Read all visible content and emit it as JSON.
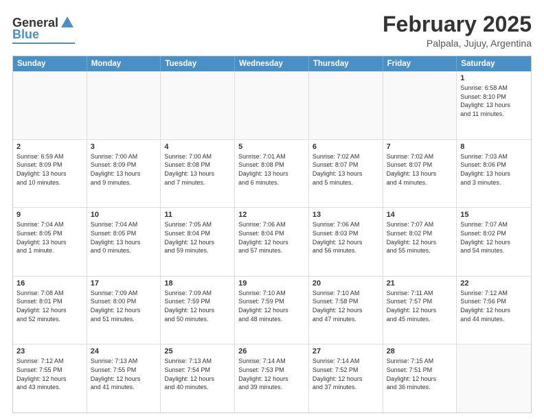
{
  "header": {
    "logo": {
      "general": "General",
      "blue": "Blue"
    },
    "title": "February 2025",
    "location": "Palpala, Jujuy, Argentina"
  },
  "weekdays": [
    "Sunday",
    "Monday",
    "Tuesday",
    "Wednesday",
    "Thursday",
    "Friday",
    "Saturday"
  ],
  "weeks": [
    [
      {
        "day": "",
        "text": ""
      },
      {
        "day": "",
        "text": ""
      },
      {
        "day": "",
        "text": ""
      },
      {
        "day": "",
        "text": ""
      },
      {
        "day": "",
        "text": ""
      },
      {
        "day": "",
        "text": ""
      },
      {
        "day": "1",
        "text": "Sunrise: 6:58 AM\nSunset: 8:10 PM\nDaylight: 13 hours\nand 11 minutes."
      }
    ],
    [
      {
        "day": "2",
        "text": "Sunrise: 6:59 AM\nSunset: 8:09 PM\nDaylight: 13 hours\nand 10 minutes."
      },
      {
        "day": "3",
        "text": "Sunrise: 7:00 AM\nSunset: 8:09 PM\nDaylight: 13 hours\nand 9 minutes."
      },
      {
        "day": "4",
        "text": "Sunrise: 7:00 AM\nSunset: 8:08 PM\nDaylight: 13 hours\nand 7 minutes."
      },
      {
        "day": "5",
        "text": "Sunrise: 7:01 AM\nSunset: 8:08 PM\nDaylight: 13 hours\nand 6 minutes."
      },
      {
        "day": "6",
        "text": "Sunrise: 7:02 AM\nSunset: 8:07 PM\nDaylight: 13 hours\nand 5 minutes."
      },
      {
        "day": "7",
        "text": "Sunrise: 7:02 AM\nSunset: 8:07 PM\nDaylight: 13 hours\nand 4 minutes."
      },
      {
        "day": "8",
        "text": "Sunrise: 7:03 AM\nSunset: 8:06 PM\nDaylight: 13 hours\nand 3 minutes."
      }
    ],
    [
      {
        "day": "9",
        "text": "Sunrise: 7:04 AM\nSunset: 8:05 PM\nDaylight: 13 hours\nand 1 minute."
      },
      {
        "day": "10",
        "text": "Sunrise: 7:04 AM\nSunset: 8:05 PM\nDaylight: 13 hours\nand 0 minutes."
      },
      {
        "day": "11",
        "text": "Sunrise: 7:05 AM\nSunset: 8:04 PM\nDaylight: 12 hours\nand 59 minutes."
      },
      {
        "day": "12",
        "text": "Sunrise: 7:06 AM\nSunset: 8:04 PM\nDaylight: 12 hours\nand 57 minutes."
      },
      {
        "day": "13",
        "text": "Sunrise: 7:06 AM\nSunset: 8:03 PM\nDaylight: 12 hours\nand 56 minutes."
      },
      {
        "day": "14",
        "text": "Sunrise: 7:07 AM\nSunset: 8:02 PM\nDaylight: 12 hours\nand 55 minutes."
      },
      {
        "day": "15",
        "text": "Sunrise: 7:07 AM\nSunset: 8:02 PM\nDaylight: 12 hours\nand 54 minutes."
      }
    ],
    [
      {
        "day": "16",
        "text": "Sunrise: 7:08 AM\nSunset: 8:01 PM\nDaylight: 12 hours\nand 52 minutes."
      },
      {
        "day": "17",
        "text": "Sunrise: 7:09 AM\nSunset: 8:00 PM\nDaylight: 12 hours\nand 51 minutes."
      },
      {
        "day": "18",
        "text": "Sunrise: 7:09 AM\nSunset: 7:59 PM\nDaylight: 12 hours\nand 50 minutes."
      },
      {
        "day": "19",
        "text": "Sunrise: 7:10 AM\nSunset: 7:59 PM\nDaylight: 12 hours\nand 48 minutes."
      },
      {
        "day": "20",
        "text": "Sunrise: 7:10 AM\nSunset: 7:58 PM\nDaylight: 12 hours\nand 47 minutes."
      },
      {
        "day": "21",
        "text": "Sunrise: 7:11 AM\nSunset: 7:57 PM\nDaylight: 12 hours\nand 45 minutes."
      },
      {
        "day": "22",
        "text": "Sunrise: 7:12 AM\nSunset: 7:56 PM\nDaylight: 12 hours\nand 44 minutes."
      }
    ],
    [
      {
        "day": "23",
        "text": "Sunrise: 7:12 AM\nSunset: 7:55 PM\nDaylight: 12 hours\nand 43 minutes."
      },
      {
        "day": "24",
        "text": "Sunrise: 7:13 AM\nSunset: 7:55 PM\nDaylight: 12 hours\nand 41 minutes."
      },
      {
        "day": "25",
        "text": "Sunrise: 7:13 AM\nSunset: 7:54 PM\nDaylight: 12 hours\nand 40 minutes."
      },
      {
        "day": "26",
        "text": "Sunrise: 7:14 AM\nSunset: 7:53 PM\nDaylight: 12 hours\nand 39 minutes."
      },
      {
        "day": "27",
        "text": "Sunrise: 7:14 AM\nSunset: 7:52 PM\nDaylight: 12 hours\nand 37 minutes."
      },
      {
        "day": "28",
        "text": "Sunrise: 7:15 AM\nSunset: 7:51 PM\nDaylight: 12 hours\nand 36 minutes."
      },
      {
        "day": "",
        "text": ""
      }
    ]
  ]
}
